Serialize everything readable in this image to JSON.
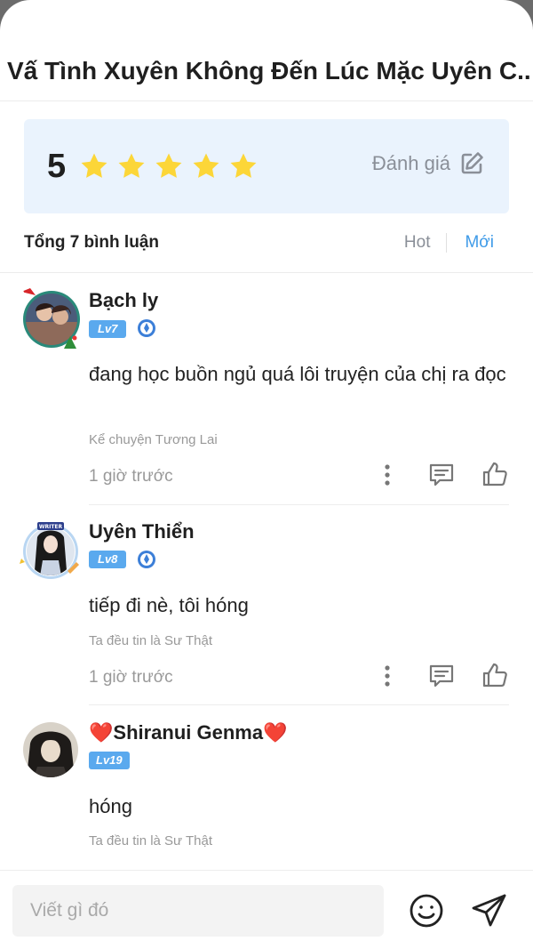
{
  "story": {
    "title": "Vấ Tình Xuyên Không Đến Lúc Mặc Uyên C..."
  },
  "rating": {
    "score": "5",
    "stars": 5,
    "rate_label": "Đánh giá",
    "star_color": "#fcd638"
  },
  "list": {
    "summary": "Tổng 7 bình luận",
    "sort_hot": "Hot",
    "sort_new": "Mới"
  },
  "comments": [
    {
      "name": "Bạch ly",
      "level": "Lv7",
      "text": "đang học buồn ngủ quá lôi truyện của chị ra đọc",
      "source": "Kể chuyện Tương Lai",
      "time": "1 giờ trước"
    },
    {
      "name": "Uyên Thiển",
      "level": "Lv8",
      "text": "tiếp đi nè, tôi hóng",
      "source": "Ta đều tin là Sư Thật",
      "time": "1 giờ trước"
    },
    {
      "name": "❤️Shiranui Genma❤️",
      "level": "Lv19",
      "text": "hóng",
      "source": "Ta đều tin là Sư Thật"
    }
  ],
  "composer": {
    "placeholder": "Viết gì đó"
  },
  "colors": {
    "accent": "#3f9be8",
    "badge": "#5aa9ee",
    "rating_bg": "#eaf3fd"
  }
}
